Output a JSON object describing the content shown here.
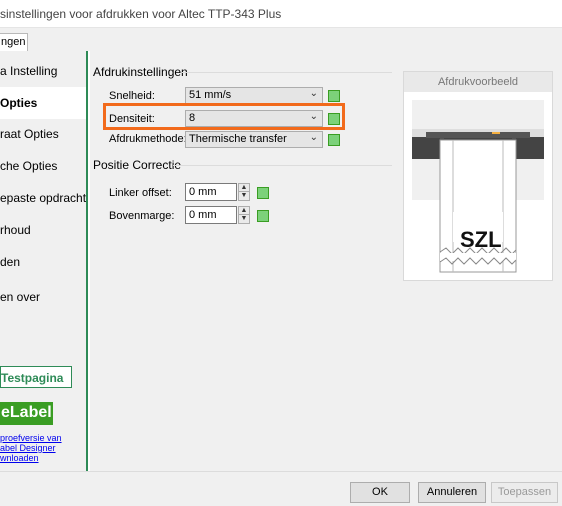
{
  "window": {
    "title": "sinstellingen voor afdrukken voor Altec TTP-343 Plus"
  },
  "tabs": [
    {
      "label": "ngen"
    }
  ],
  "sidebar": {
    "items": [
      {
        "label": "a Instelling",
        "selected": false
      },
      {
        "label": "Opties",
        "selected": true
      },
      {
        "label": "raat Opties",
        "selected": false
      },
      {
        "label": "che Opties",
        "selected": false
      },
      {
        "label": "epaste opdrachten",
        "selected": false
      },
      {
        "label": "rhoud",
        "selected": false
      },
      {
        "label": "den",
        "selected": false
      },
      {
        "label": "en over",
        "selected": false
      }
    ],
    "test_button": "Testpagina",
    "logo_text": "eLabel",
    "promo_lines": [
      "proefversie van",
      "abel Designer",
      "wnloaden"
    ]
  },
  "print_settings": {
    "group_title": "Afdrukinstellingen",
    "speed": {
      "label": "Snelheid:",
      "value": "51 mm/s"
    },
    "density": {
      "label": "Densiteit:",
      "value": "8"
    },
    "method": {
      "label": "Afdrukmethode:",
      "value": "Thermische transfer"
    }
  },
  "position_correction": {
    "group_title": "Positie Correctie",
    "left_offset": {
      "label": "Linker offset:",
      "value": "0 mm"
    },
    "top_margin": {
      "label": "Bovenmarge:",
      "value": "0 mm"
    }
  },
  "preview": {
    "title": "Afdrukvoorbeeld",
    "label_text": "SZL"
  },
  "buttons": {
    "ok": "OK",
    "cancel": "Annuleren",
    "apply": "Toepassen"
  },
  "colors": {
    "accent_green": "#2e8b57",
    "highlight_orange": "#f26a1b"
  },
  "icons": {
    "combo_arrow": "chevron-down-icon",
    "spin_up": "arrow-up-icon",
    "spin_down": "arrow-down-icon"
  }
}
